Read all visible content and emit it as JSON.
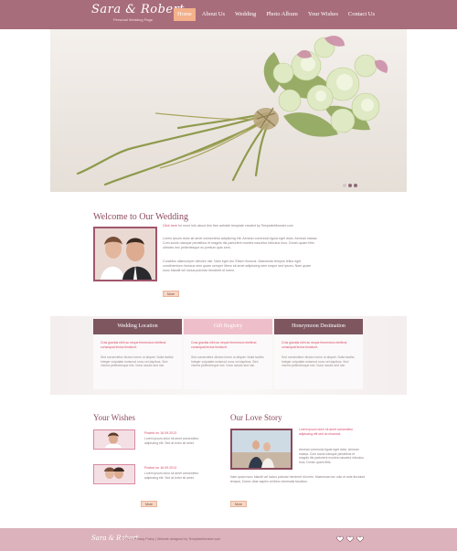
{
  "header": {
    "logo_text": "Sara & Robert",
    "logo_subtitle": "Personal Wedding Page",
    "nav": [
      {
        "label": "Home",
        "active": true
      },
      {
        "label": "About Us"
      },
      {
        "label": "Wedding"
      },
      {
        "label": "Photo Album"
      },
      {
        "label": "Your Wishes"
      },
      {
        "label": "Contact Us"
      }
    ]
  },
  "hero": {
    "slide_count": 3,
    "active_slide": 1
  },
  "welcome": {
    "title": "Welcome to Our Wedding",
    "link_text": "Click here",
    "intro": " for more info about this free website template created by TemplateMonster.com",
    "paragraph1": "Lorem ipsum dolor sit amet consectetur adipiscing elit. Aenean commodo ligula eget dolor. Aenean massa. Cum sociis natoque penatibus et magnis dis parturient montes nascetur ridiculus mus. Donec quam felis ultricies nec pellentesque eu pretium quis sem.",
    "paragraph2": "Curabitur ullamcorper ultricies nisi. Nam eget dui. Etiam rhoncus. Maecenas tempus tellus eget condimentum rhoncus sem quam semper libero sit amet adipiscing sem neque sed ipsum. Nam quam nunc blandit vel luctus pulvinar hendrerit id lorem.",
    "more_label": "More"
  },
  "columns": [
    {
      "title": "Wedding Location",
      "red_text": "Cras gravida nibh ac neque fermentum eleifend consequat lectus tincidunt.",
      "grey_text": "Sed consectetur dictum lorem ut aliquet. Nulla facilisi. Integer vulputate euismod nunc vel dapibus. Sed viverra pellentesque nisl. Nunc iaculis sed nisi."
    },
    {
      "title": "Gift Registry",
      "red_text": "Cras gravida nibh ac neque fermentum eleifend consequat lectus tincidunt.",
      "grey_text": "Sed consectetur dictum lorem ut aliquet. Nulla facilisi. Integer vulputate euismod nunc vel dapibus. Sed viverra pellentesque nisl. Nunc iaculis sed nisi."
    },
    {
      "title": "Honeymoon Destination",
      "red_text": "Cras gravida nibh ac neque fermentum eleifend consequat lectus tincidunt.",
      "grey_text": "Sed consectetur dictum lorem ut aliquet. Nulla facilisi. Integer vulputate euismod nunc vel dapibus. Sed viverra pellentesque nisl. Nunc iaculis sed nisi."
    }
  ],
  "wishes": {
    "title": "Your Wishes",
    "items": [
      {
        "date": "Posted on 16.09.2013",
        "text": "Lorem ipsum dolor sit amet consectetur adipiscing elit. Sed at tortor sit amet."
      },
      {
        "date": "Posted on 16.09.2013",
        "text": "Lorem ipsum dolor sit amet consectetur adipiscing elit. Sed at tortor sit amet."
      }
    ],
    "more_label": "More"
  },
  "story": {
    "title": "Our Love Story",
    "side_red": "Lorem ipsum dolor sit amet consectetur adipiscing elit sed do eiusmod.",
    "side_grey": "Aenean commodo ligula eget dolor. Aenean massa. Cum sociis natoque penatibus et magnis dis parturient montes nascetur ridiculus mus. Donec quam felis.",
    "bottom_text": "Nam quam nunc blandit vel luctus pulvinar hendrerit id lorem. Maecenas nec odio et ante tincidunt tempus. Donec vitae sapien ut libero venenatis faucibus.",
    "more_label": "More"
  },
  "footer": {
    "logo_text": "Sara & Robert",
    "copy": "© 2013 | Privacy Policy | Website designed by TemplateMonster.com"
  },
  "colors": {
    "header": "#a86d7b",
    "accent": "#8c4a5c",
    "link": "#d64c6a",
    "footer": "#dcb3bd"
  }
}
